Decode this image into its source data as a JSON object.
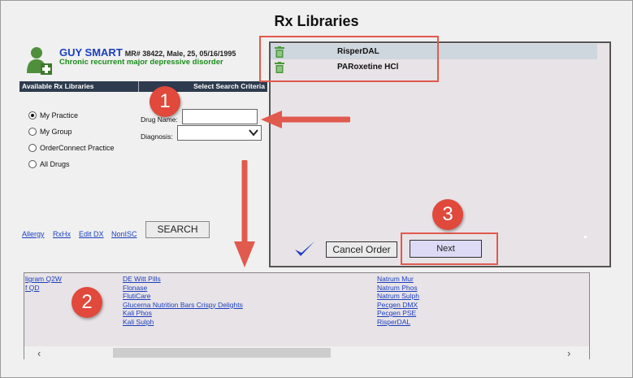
{
  "page": {
    "title": "Rx Libraries"
  },
  "patient": {
    "name": "GUY SMART",
    "meta": "MR# 38422, Male, 25, 05/16/1995",
    "diagnosis": "Chronic recurrent major depressive disorder"
  },
  "headers": {
    "left": "Available Rx Libraries",
    "right": "Select Search Criteria"
  },
  "libraries": [
    {
      "label": "My Practice",
      "selected": true
    },
    {
      "label": "My Group",
      "selected": false
    },
    {
      "label": "OrderConnect Practice",
      "selected": false
    },
    {
      "label": "All Drugs",
      "selected": false
    }
  ],
  "form": {
    "drug_label": "Drug Name:",
    "drug_value": "",
    "diagnosis_label": "Diagnosis:",
    "diagnosis_value": ""
  },
  "links": [
    "Allergy",
    "RxHx",
    "Edit DX",
    "NonISC"
  ],
  "search_label": "SEARCH",
  "selected_drugs": [
    {
      "name": "RisperDAL",
      "highlight": true
    },
    {
      "name": "PARoxetine HCl",
      "highlight": false
    }
  ],
  "buttons": {
    "cancel": "Cancel Order",
    "next": "Next"
  },
  "results": {
    "col1": [
      "ligram Q2W",
      "f QD"
    ],
    "col2": [
      "DE Witt Pills",
      "Flonase",
      "FlutiCare",
      "Glucerna Nutrition Bars Crispy Delights",
      "Kali Phos",
      "Kali Sulph"
    ],
    "col3": [
      "Natrum Mur",
      "Natrum Phos",
      "Natrum Sulph",
      "Pecgen DMX",
      "Pecgen PSE",
      "RisperDAL"
    ]
  },
  "scroll": {
    "left": "‹",
    "right": "›"
  },
  "callouts": [
    "1",
    "2",
    "3"
  ],
  "colors": {
    "callout": "#e0493b",
    "patient_name": "#1a3fbf",
    "diagnosis": "#1a8c1a",
    "header_bar": "#2e3b4e"
  },
  "icons": [
    "patient-avatar-icon",
    "trash-icon",
    "checkmark-icon",
    "chevron-down-icon"
  ]
}
